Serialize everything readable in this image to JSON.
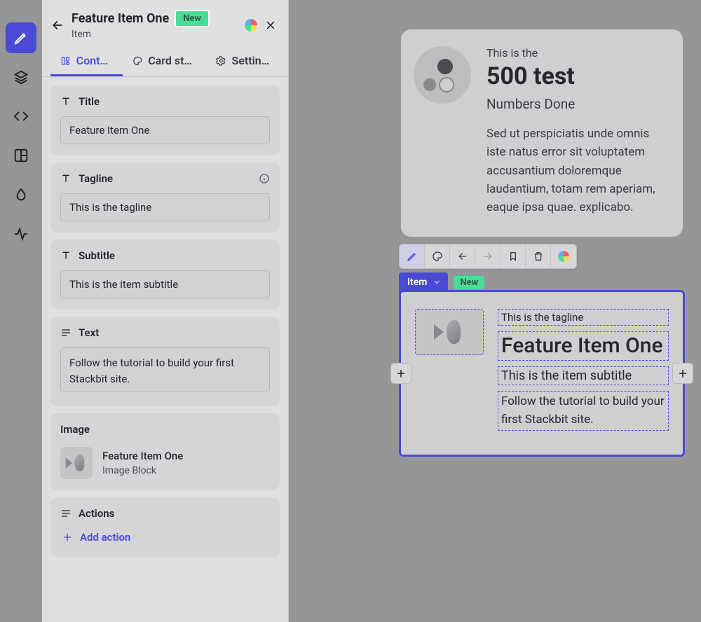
{
  "rail": {
    "items": [
      {
        "name": "edit",
        "active": true
      },
      {
        "name": "layers"
      },
      {
        "name": "code"
      },
      {
        "name": "layout"
      },
      {
        "name": "color"
      },
      {
        "name": "activity"
      }
    ]
  },
  "panel": {
    "title": "Feature Item One",
    "badge": "New",
    "subtitle": "Item",
    "tabs": [
      {
        "label": "Content",
        "active": true
      },
      {
        "label": "Card styl…",
        "active": false
      },
      {
        "label": "Settings",
        "active": false
      }
    ],
    "fields": {
      "title": {
        "label": "Title",
        "value": "Feature Item One"
      },
      "tagline": {
        "label": "Tagline",
        "value": "This is the tagline",
        "info": true
      },
      "subtitle": {
        "label": "Subtitle",
        "value": "This is the item subtitle"
      },
      "text": {
        "label": "Text",
        "value": "Follow the tutorial to build your first Stackbit site."
      },
      "image": {
        "label": "Image",
        "name": "Feature Item One",
        "type": "Image Block"
      },
      "actions": {
        "label": "Actions",
        "add_label": "Add action"
      }
    }
  },
  "top_card": {
    "tagline": "This is the",
    "title": "500 test",
    "subtitle": "Numbers Done",
    "body": "Sed ut perspiciatis unde omnis iste natus error sit voluptatem accusantium doloremque laudantium, totam rem aperiam, eaque ipsa quae. explicabo."
  },
  "toolbar": {
    "items": [
      "edit",
      "style",
      "back",
      "forward",
      "bookmark",
      "delete",
      "logo"
    ]
  },
  "item_tag": {
    "label": "Item",
    "badge": "New"
  },
  "preview_card": {
    "tagline": "This is the tagline",
    "title": "Feature Item One",
    "subtitle": "This is the item subtitle",
    "body": "Follow the tutorial to build your first Stackbit site."
  },
  "colors": {
    "accent": "#4a4ad4",
    "badge_bg": "#4cdc98"
  }
}
